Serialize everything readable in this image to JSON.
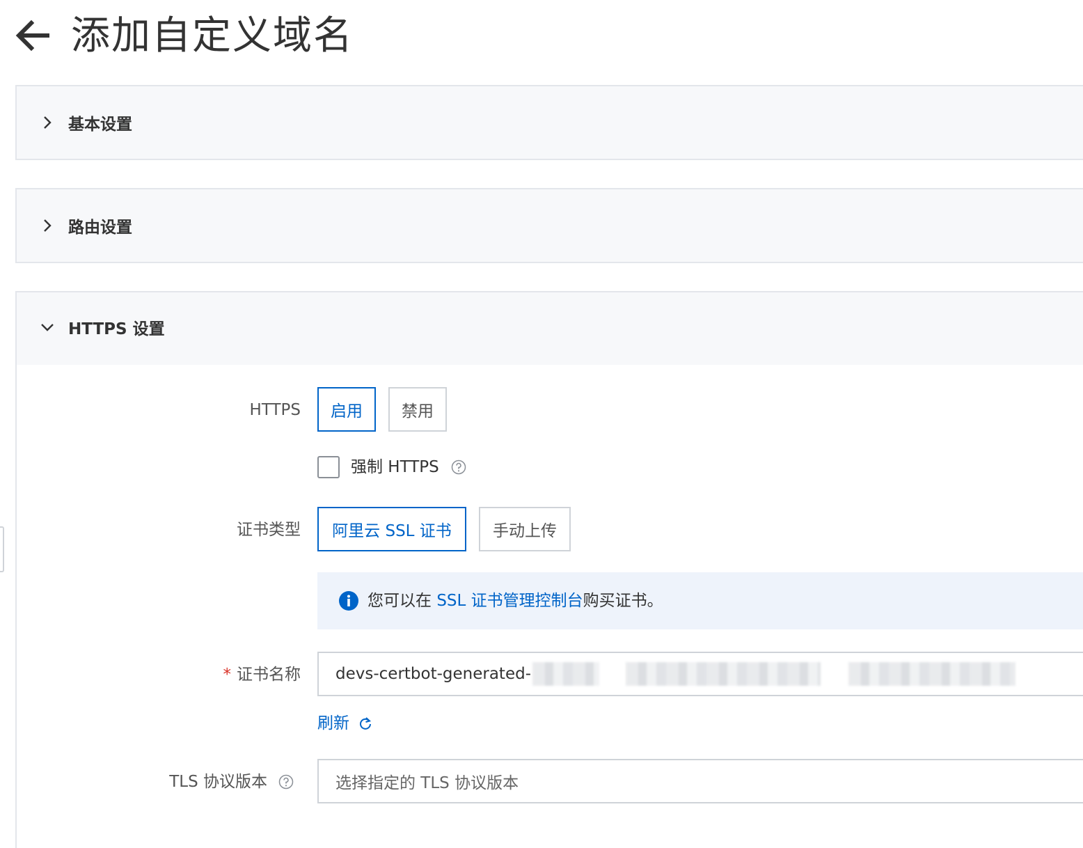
{
  "header": {
    "title": "添加自定义域名",
    "back_icon": "arrow-left-icon"
  },
  "panels": {
    "basic": {
      "title": "基本设置",
      "expanded": false
    },
    "route": {
      "title": "路由设置",
      "expanded": false
    },
    "https": {
      "title": "HTTPS 设置",
      "expanded": true
    }
  },
  "https_form": {
    "https_label": "HTTPS",
    "https_options": [
      "启用",
      "禁用"
    ],
    "https_selected": "启用",
    "force_https_label": "强制 HTTPS",
    "force_https_checked": false,
    "cert_type_label": "证书类型",
    "cert_type_options": [
      "阿里云 SSL 证书",
      "手动上传"
    ],
    "cert_type_selected": "阿里云 SSL 证书",
    "info_prefix": "您可以在 ",
    "info_link": "SSL 证书管理控制台",
    "info_suffix": "购买证书。",
    "cert_name_required": "*",
    "cert_name_label": "证书名称",
    "cert_name_value": "devs-certbot-generated-",
    "refresh_label": "刷新",
    "tls_label": "TLS 协议版本",
    "tls_placeholder": "选择指定的 TLS 协议版本"
  },
  "colors": {
    "accent": "#0064c8",
    "required": "#d93026",
    "info_bg": "#eef3fb",
    "panel_bg": "#f7f8fa",
    "border": "#cfd3d8"
  }
}
